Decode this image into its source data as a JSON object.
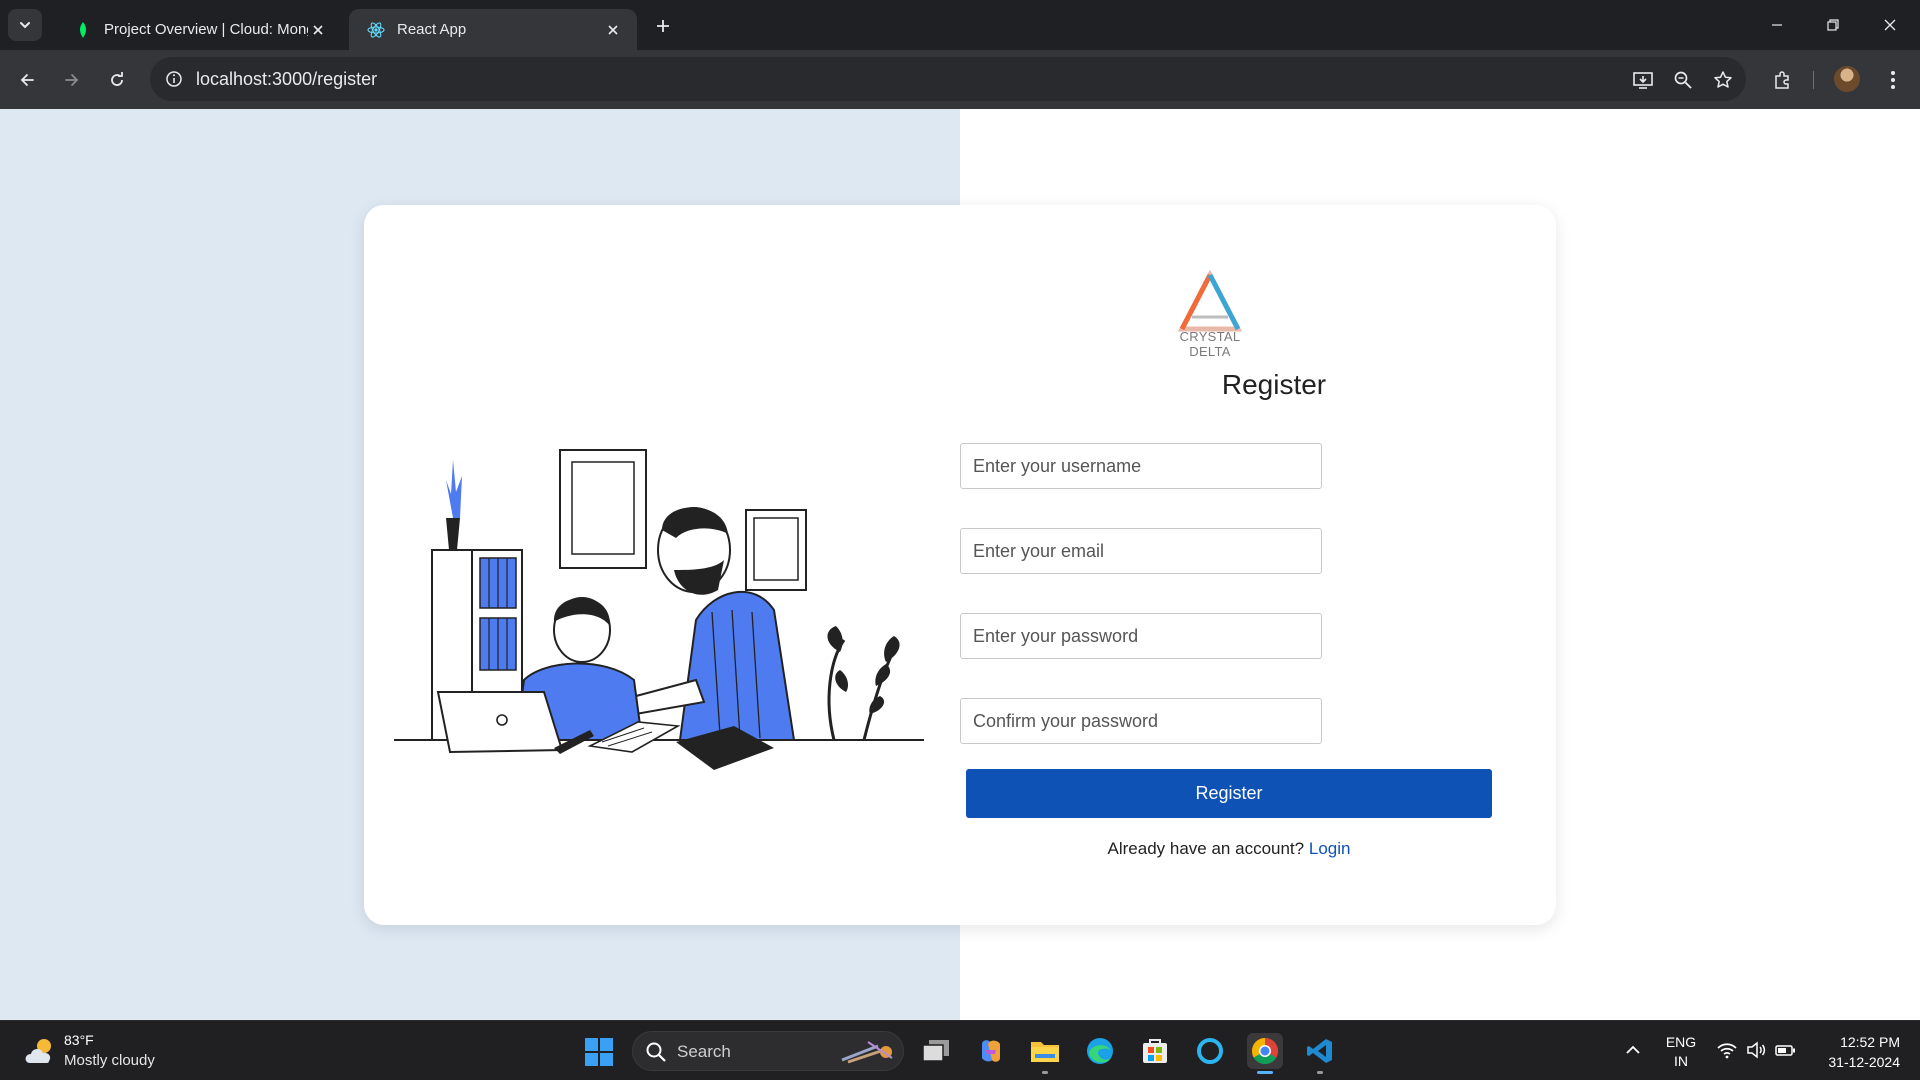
{
  "browser": {
    "tabs": [
      {
        "title": "Project Overview | Cloud: Mong",
        "favicon": "mongodb-leaf-icon",
        "active": false
      },
      {
        "title": "React App",
        "favicon": "react-icon",
        "active": true
      }
    ],
    "url": "localhost:3000/register"
  },
  "page": {
    "logo_text": "CRYSTAL DELTA",
    "title": "Register",
    "fields": {
      "username": {
        "placeholder": "Enter your username",
        "value": ""
      },
      "email": {
        "placeholder": "Enter your email",
        "value": ""
      },
      "password": {
        "placeholder": "Enter your password",
        "value": ""
      },
      "confirm": {
        "placeholder": "Confirm your password",
        "value": ""
      }
    },
    "submit_label": "Register",
    "footer_text": "Already have an account?",
    "login_link": "Login"
  },
  "taskbar": {
    "weather": {
      "temp": "83°F",
      "desc": "Mostly cloudy"
    },
    "search_label": "Search",
    "apps": [
      "task-view-icon",
      "copilot-icon",
      "file-explorer-icon",
      "edge-icon",
      "microsoft-store-icon",
      "cortana-icon",
      "chrome-icon",
      "vscode-icon"
    ],
    "lang": {
      "line1": "ENG",
      "line2": "IN"
    },
    "time": "12:52 PM",
    "date": "31-12-2024"
  },
  "colors": {
    "primary_button": "#0e52b6",
    "link": "#0e52b6",
    "left_panel_bg": "#dde8f3",
    "illustration_accent": "#4f7bf0",
    "chrome_dark": "#1f2023"
  }
}
